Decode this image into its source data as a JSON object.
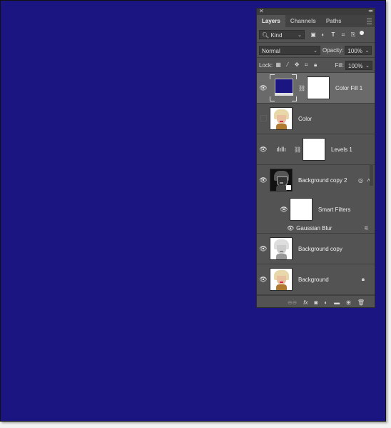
{
  "canvas": {
    "fill_color": "#1a1580"
  },
  "panel": {
    "tabs": [
      {
        "label": "Layers",
        "active": true
      },
      {
        "label": "Channels",
        "active": false
      },
      {
        "label": "Paths",
        "active": false
      }
    ],
    "filter": {
      "label": "Kind",
      "icons": [
        "pixel-filter-icon",
        "adjustment-filter-icon",
        "type-filter-icon",
        "shape-filter-icon",
        "smart-object-filter-icon"
      ]
    },
    "blend_mode": "Normal",
    "opacity_label": "Opacity:",
    "opacity_value": "100%",
    "lock_label": "Lock:",
    "fill_label": "Fill:",
    "fill_value": "100%",
    "layers": [
      {
        "name": "Color Fill 1",
        "visible": true,
        "selected": true,
        "type": "fill"
      },
      {
        "name": "Color",
        "visible": false,
        "selected": false,
        "type": "pixel"
      },
      {
        "name": "Levels 1",
        "visible": true,
        "selected": false,
        "type": "adjustment"
      },
      {
        "name": "Background copy 2",
        "visible": true,
        "selected": false,
        "type": "smart-object"
      },
      {
        "name": "Background copy",
        "visible": true,
        "selected": false,
        "type": "pixel"
      },
      {
        "name": "Background",
        "visible": true,
        "selected": false,
        "type": "pixel",
        "locked": true
      }
    ],
    "smart_filters_label": "Smart Filters",
    "smart_filter_items": [
      {
        "name": "Gaussian Blur",
        "visible": true
      }
    ],
    "footer_icons": [
      "link-layers-icon",
      "fx-icon",
      "add-mask-icon",
      "new-adjustment-icon",
      "new-group-icon",
      "new-layer-icon",
      "delete-icon"
    ]
  }
}
